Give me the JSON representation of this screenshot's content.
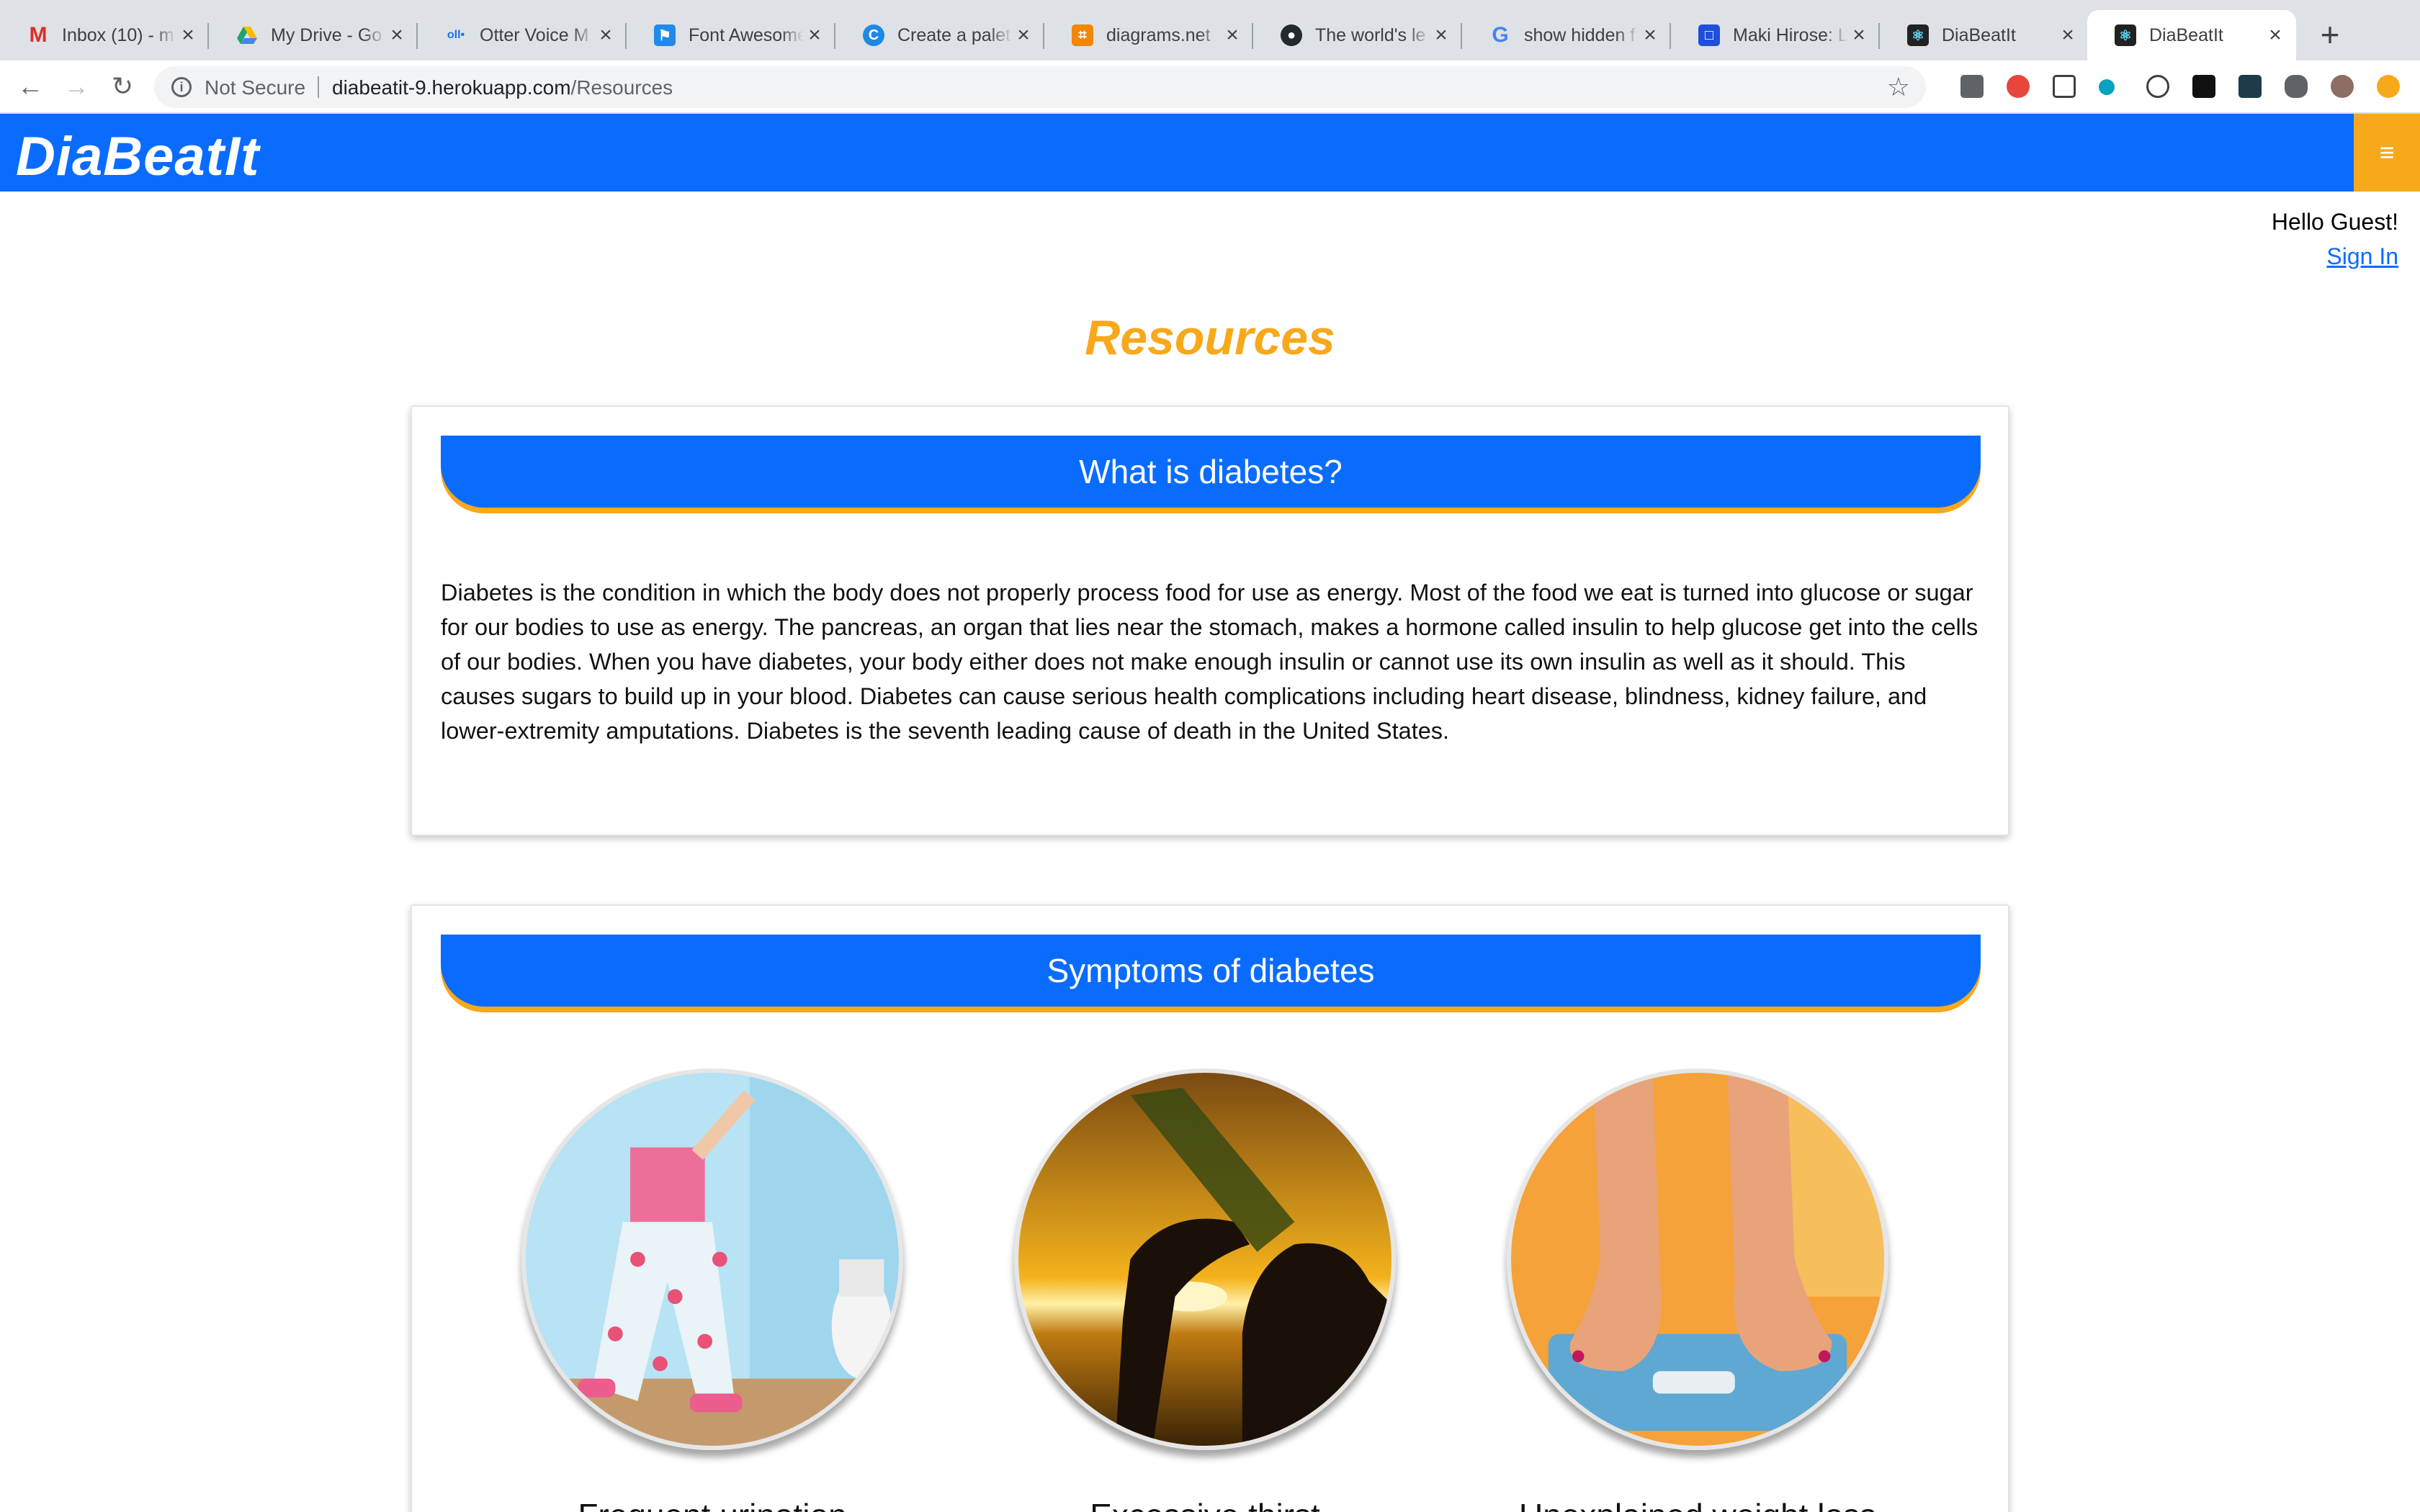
{
  "browser": {
    "tabs": [
      {
        "title": "Inbox (10) - m",
        "favicon": "gmail-icon",
        "color": "#d93025"
      },
      {
        "title": "My Drive - Go",
        "favicon": "drive-icon",
        "color": "#1fa463"
      },
      {
        "title": "Otter Voice M",
        "favicon": "otter-icon",
        "color": "#1a73e8"
      },
      {
        "title": "Font Awesome",
        "favicon": "flag-icon",
        "color": "#228ae6"
      },
      {
        "title": "Create a palet",
        "favicon": "coolors-icon",
        "color": "#1e88e5"
      },
      {
        "title": "diagrams.net",
        "favicon": "diagrams-icon",
        "color": "#f08705"
      },
      {
        "title": "The world's le",
        "favicon": "github-icon",
        "color": "#24292e"
      },
      {
        "title": "show hidden f",
        "favicon": "google-icon",
        "color": "#4285f4"
      },
      {
        "title": "Maki Hirose: L",
        "favicon": "square-icon",
        "color": "#1f4fd8"
      },
      {
        "title": "DiaBeatIt",
        "favicon": "react-icon",
        "color": "#222222"
      },
      {
        "title": "DiaBeatIt",
        "favicon": "react-icon",
        "color": "#222222"
      }
    ],
    "new_tab_symbol": "+",
    "close_symbol": "×",
    "security_label": "Not Secure",
    "url_host": "diabeatit-9.herokuapp.com",
    "url_path": "/Resources"
  },
  "app": {
    "brand": "DiaBeatIt",
    "menu_icon": "≡",
    "greeting": "Hello Guest!",
    "sign_in": "Sign In",
    "page_title": "Resources",
    "colors": {
      "primary": "#0a6cff",
      "accent": "#f7a81b"
    }
  },
  "sections": {
    "what_is": {
      "heading": "What is diabetes?",
      "body": "Diabetes is the condition in which the body does not properly process food for use as energy. Most of the food we eat is turned into glucose or sugar for our bodies to use as energy. The pancreas, an organ that lies near the stomach, makes a hormone called insulin to help glucose get into the cells of our bodies. When you have diabetes, your body either does not make enough insulin or cannot use its own insulin as well as it should. This causes sugars to build up in your blood. Diabetes can cause serious health complications including heart disease, blindness, kidney failure, and lower-extremity amputations. Diabetes is the seventh leading cause of death in the United States."
    },
    "symptoms": {
      "heading": "Symptoms of diabetes",
      "items": [
        {
          "image": "frequent-urination-photo",
          "caption": "Frequent urination"
        },
        {
          "image": "excessive-thirst-photo",
          "caption": "Excessive thirst"
        },
        {
          "image": "unexplained-weight-loss-photo",
          "caption": "Unexplained weight loss"
        }
      ]
    }
  }
}
